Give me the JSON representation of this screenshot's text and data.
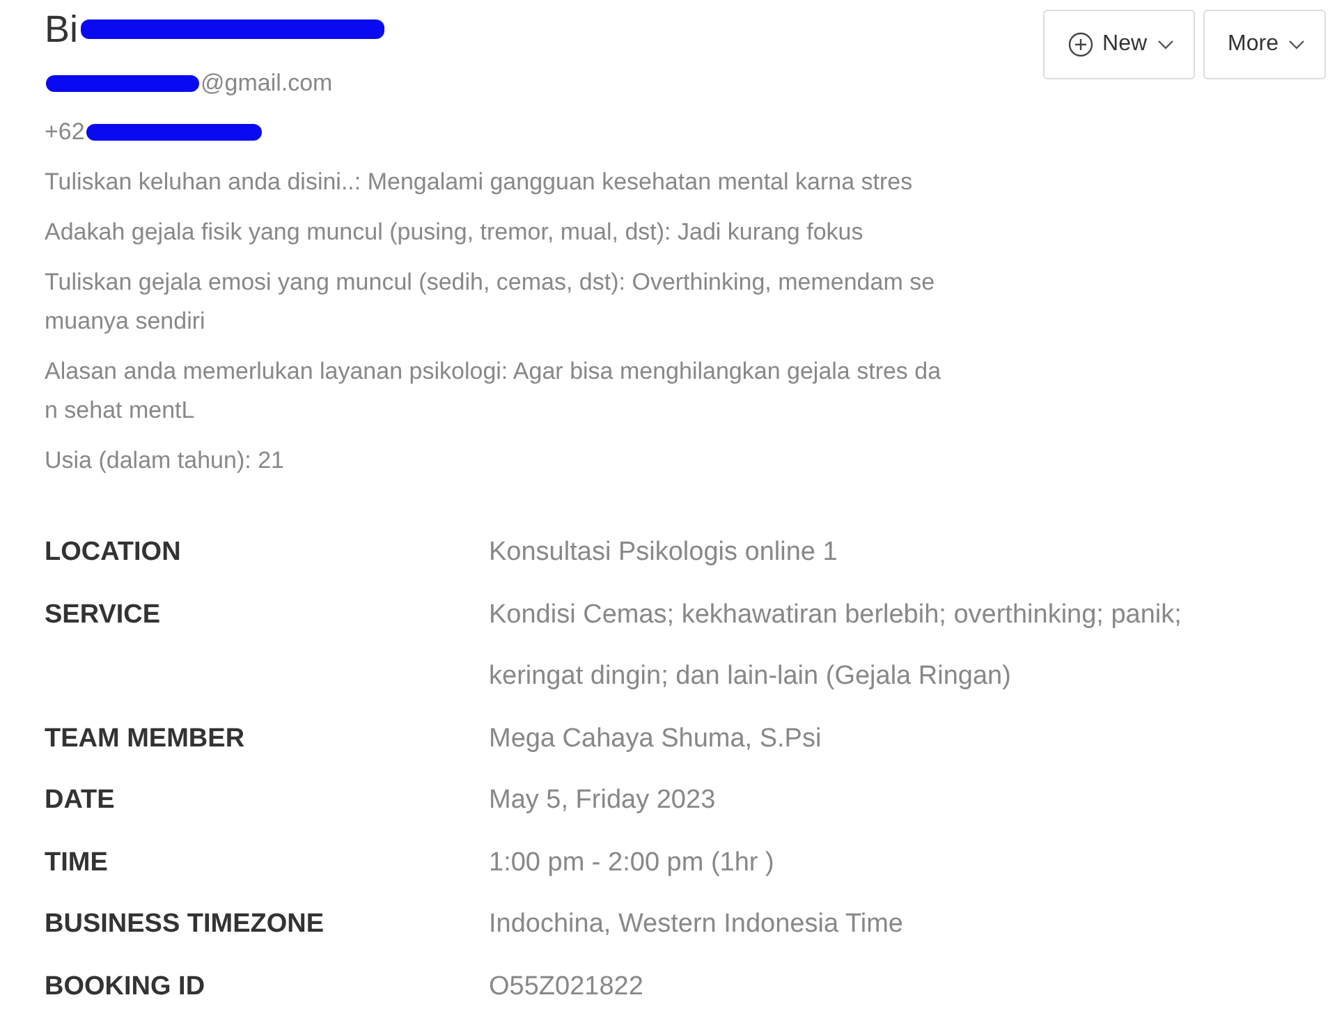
{
  "header": {
    "name_visible": "Bi",
    "email_visible": "@gmail.com",
    "phone_visible": "+62"
  },
  "buttons": [
    {
      "label": "New",
      "kind": "new"
    },
    {
      "label": "More",
      "kind": "more"
    }
  ],
  "answers": [
    {
      "lines": [
        "Tuliskan keluhan anda disini..: Mengalami gangguan kesehatan mental karna stres"
      ]
    },
    {
      "lines": [
        "Adakah gejala fisik yang muncul (pusing, tremor, mual, dst): Jadi kurang fokus"
      ]
    },
    {
      "lines": [
        "Tuliskan gejala emosi yang muncul (sedih, cemas, dst): Overthinking, memendam se",
        "muanya sendiri"
      ]
    },
    {
      "lines": [
        "Alasan anda memerlukan layanan psikologi: Agar bisa menghilangkan gejala stres da",
        "n sehat mentL"
      ]
    },
    {
      "lines": [
        "Usia (dalam tahun): 21"
      ]
    }
  ],
  "details": [
    {
      "label": "LOCATION",
      "value_lines": [
        "Konsultasi Psikologis online 1"
      ]
    },
    {
      "label": "SERVICE",
      "value_lines": [
        "Kondisi Cemas; kekhawatiran berlebih; overthinking; panik;",
        "keringat dingin; dan lain-lain (Gejala Ringan)"
      ]
    },
    {
      "label": "TEAM MEMBER",
      "value_lines": [
        "Mega Cahaya Shuma, S.Psi"
      ]
    },
    {
      "label": "DATE",
      "value_lines": [
        "May 5, Friday 2023"
      ]
    },
    {
      "label": "TIME",
      "value_lines": [
        "1:00 pm - 2:00 pm (1hr )"
      ]
    },
    {
      "label": "BUSINESS TIMEZONE",
      "value_lines": [
        "Indochina, Western Indonesia Time"
      ]
    },
    {
      "label": "BOOKING ID",
      "value_lines": [
        "O55Z021822"
      ]
    }
  ]
}
